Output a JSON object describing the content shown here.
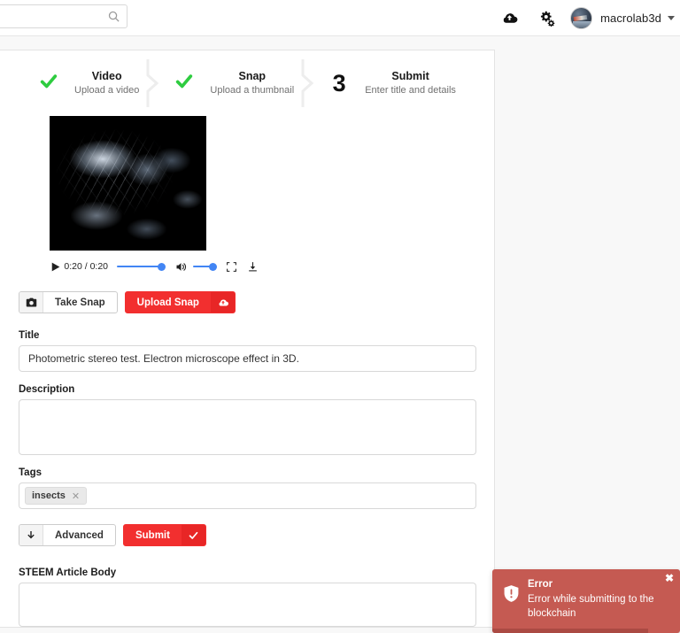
{
  "header": {
    "search": {
      "value": "",
      "placeholder": "",
      "icon": "search-icon"
    },
    "upload_icon": "cloud-upload-icon",
    "settings_icon": "gears-icon",
    "username": "macrolab3d",
    "caret_icon": "chevron-down-icon"
  },
  "steps": [
    {
      "mark": "check",
      "number": "",
      "title": "Video",
      "subtitle": "Upload a video"
    },
    {
      "mark": "check",
      "number": "",
      "title": "Snap",
      "subtitle": "Upload a thumbnail"
    },
    {
      "mark": "number",
      "number": "3",
      "title": "Submit",
      "subtitle": "Enter title and details"
    }
  ],
  "video": {
    "play_icon": "play-icon",
    "time": "0:20 / 0:20",
    "progress_percent": 100,
    "volume_percent": 100,
    "mute_icon": "volume-icon",
    "fullscreen_icon": "fullscreen-icon",
    "download_icon": "download-icon"
  },
  "snap_buttons": {
    "take_snap_label": "Take Snap",
    "take_snap_icon": "camera-icon",
    "upload_snap_label": "Upload Snap",
    "upload_snap_icon": "cloud-upload-icon"
  },
  "form": {
    "title_label": "Title",
    "title_value": "Photometric stereo test. Electron microscope effect in 3D.",
    "title_placeholder": "",
    "description_label": "Description",
    "description_value": "",
    "description_placeholder": "",
    "tags_label": "Tags",
    "tags": [
      {
        "label": "insects",
        "remove_icon": "close-icon"
      }
    ],
    "advanced_label": "Advanced",
    "advanced_icon": "arrow-down-icon",
    "submit_label": "Submit",
    "submit_icon": "check-icon",
    "article_label": "STEEM Article Body",
    "article_value": "",
    "article_placeholder": ""
  },
  "toast": {
    "title": "Error",
    "message": "Error while submitting to the blockchain",
    "icon": "error-shield-icon",
    "close_label": "✖",
    "progress_percent": 83,
    "color": "#c55a52"
  },
  "colors": {
    "accent_red": "#f22f2f",
    "check_green": "#2ecc40",
    "slider_blue": "#4285f4",
    "page_bg": "#f8f8f8"
  }
}
